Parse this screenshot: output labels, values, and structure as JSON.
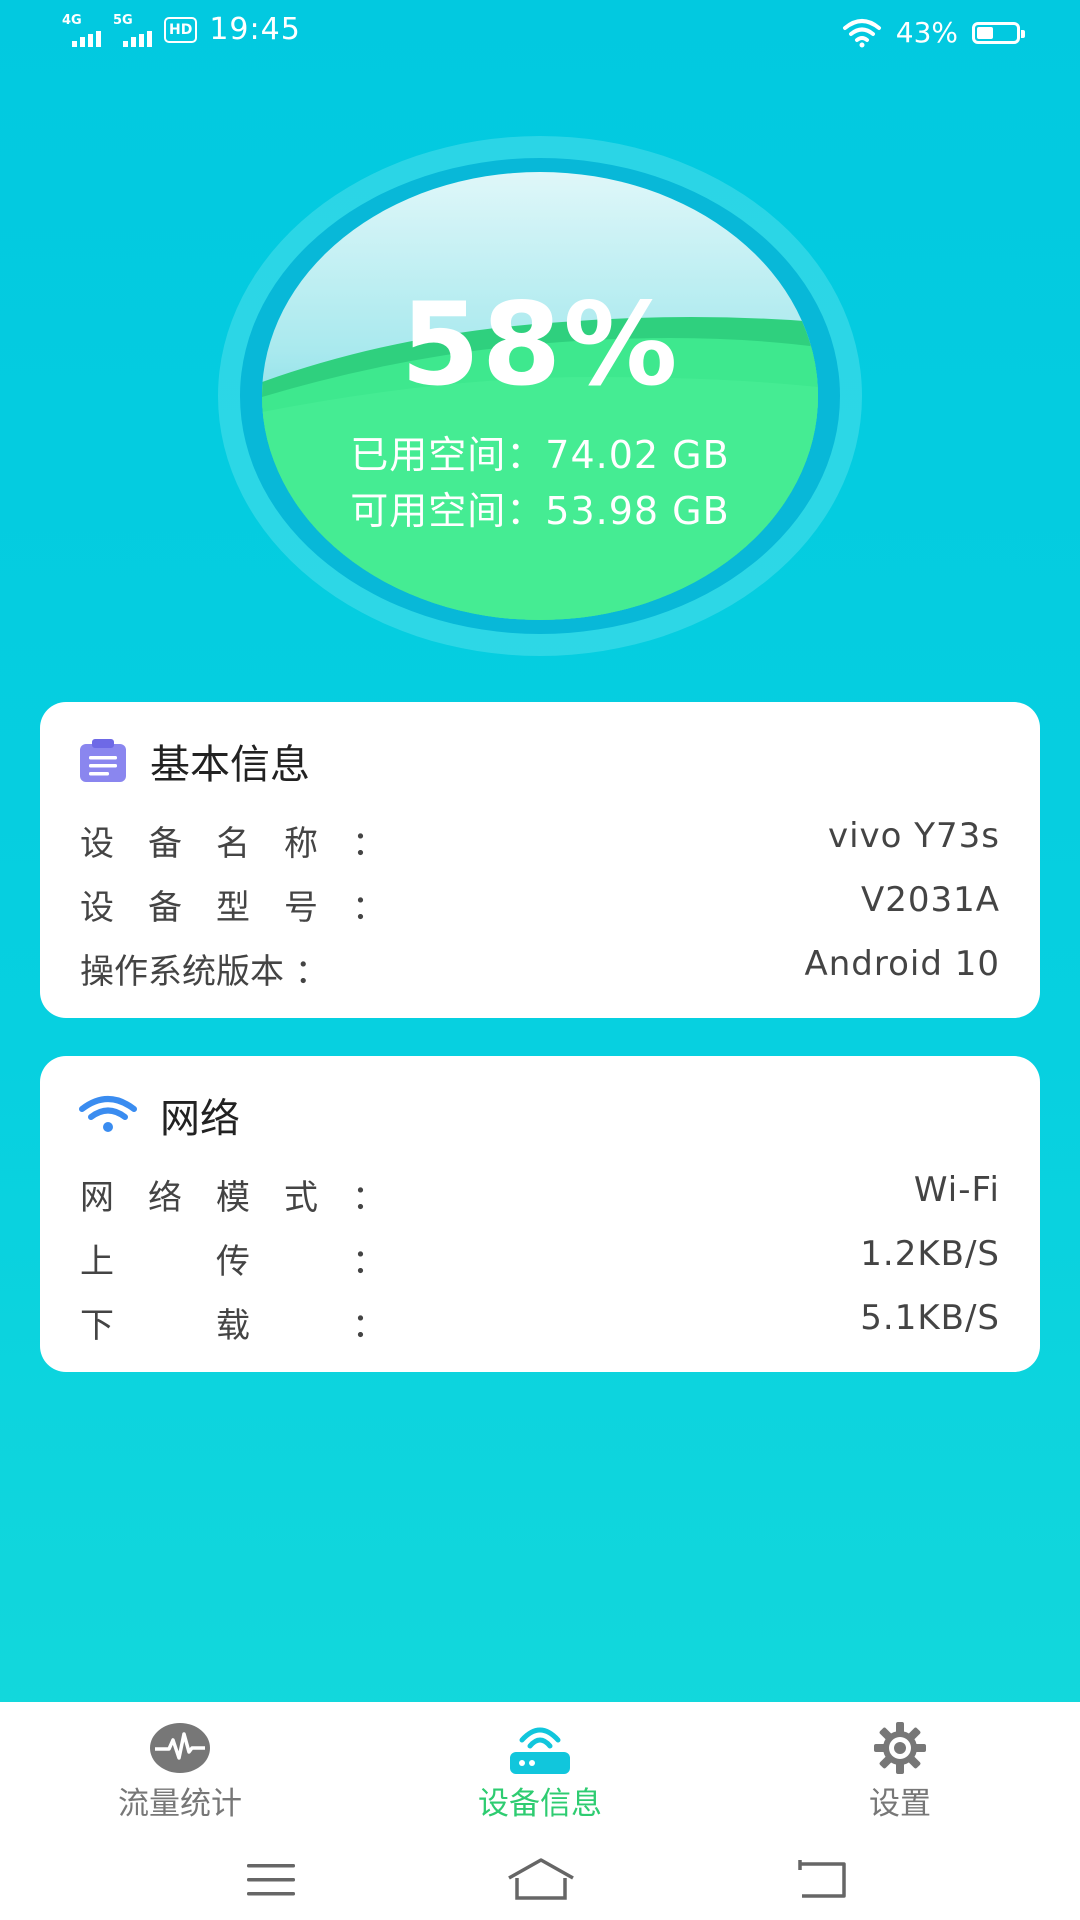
{
  "status_bar": {
    "net1": "4G",
    "net2": "5G",
    "hd": "HD",
    "time": "19:45",
    "battery": "43%",
    "battery_level": 0.43
  },
  "storage": {
    "percent": "58%",
    "used": "已用空间：74.02  GB",
    "free": "可用空间：53.98  GB"
  },
  "basic_info": {
    "title": "基本信息",
    "rows": [
      {
        "label": "设　备　名　称　：",
        "value": "vivo  Y73s"
      },
      {
        "label": "设　备　型　号　：",
        "value": "V2031A"
      },
      {
        "label": "操作系统版本 ：",
        "value": "Android  10"
      }
    ]
  },
  "network": {
    "title": "网络",
    "rows": [
      {
        "label": "网　络　模　式　：",
        "value": "Wi-Fi"
      },
      {
        "label": "上　　　传　　　：",
        "value": "1.2KB/S"
      },
      {
        "label": "下　　　载　　　：",
        "value": "5.1KB/S"
      }
    ]
  },
  "bottom_nav": {
    "tabs": [
      {
        "label": "流量统计",
        "icon": "pulse-icon",
        "active": false
      },
      {
        "label": "设备信息",
        "icon": "router-icon",
        "active": true
      },
      {
        "label": "设置",
        "icon": "gear-icon",
        "active": false
      }
    ],
    "active_color": "#2ecc71",
    "inactive_color": "#777777"
  },
  "colors": {
    "accent_green": "#3ee88e",
    "background_cyan": "#02c9e0"
  }
}
